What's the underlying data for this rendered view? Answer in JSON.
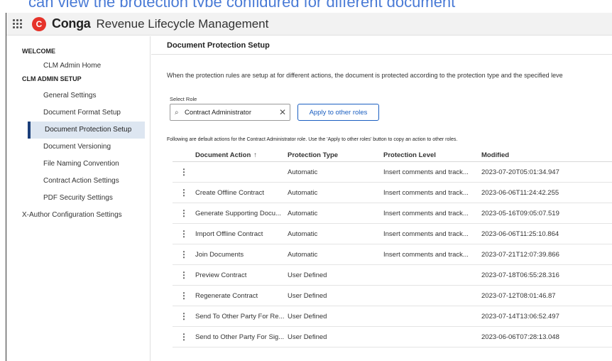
{
  "caption": "can view the protection type configured for different document",
  "header": {
    "brand": "Conga",
    "logo_letter": "C",
    "app_name": "Revenue Lifecycle Management"
  },
  "sidebar": {
    "sections": [
      {
        "title": "WELCOME",
        "items": [
          "CLM Admin Home"
        ]
      },
      {
        "title": "CLM ADMIN SETUP",
        "items": [
          "General Settings",
          "Document Format Setup",
          "Document Protection Setup",
          "Document Versioning",
          "File Naming Convention",
          "Contract Action Settings",
          "PDF Security Settings",
          "X-Author Configuration Settings"
        ]
      }
    ],
    "active_item": "Document Protection Setup"
  },
  "main": {
    "title": "Document Protection Setup",
    "intro": "When the protection rules are setup at for different actions, the document is protected according to the protection type and the specified leve",
    "role_label": "Select Role",
    "role_value": "Contract Administrator",
    "apply_button": "Apply to other roles",
    "note": "Following are default actions for the Contract Administrator role. Use the 'Apply to other roles' button to copy an action to other roles.",
    "table": {
      "headers": [
        "Document Action",
        "Protection Type",
        "Protection Level",
        "Modified"
      ],
      "rows": [
        {
          "action": "",
          "type": "Automatic",
          "level": "Insert comments and track...",
          "modified": "2023-07-20T05:01:34.947"
        },
        {
          "action": "Create Offline Contract",
          "type": "Automatic",
          "level": "Insert comments and track...",
          "modified": "2023-06-06T11:24:42.255"
        },
        {
          "action": "Generate Supporting Docu...",
          "type": "Automatic",
          "level": "Insert comments and track...",
          "modified": "2023-05-16T09:05:07.519"
        },
        {
          "action": "Import Offline Contract",
          "type": "Automatic",
          "level": "Insert comments and track...",
          "modified": "2023-06-06T11:25:10.864"
        },
        {
          "action": "Join Documents",
          "type": "Automatic",
          "level": "Insert comments and track...",
          "modified": "2023-07-21T12:07:39.866"
        },
        {
          "action": "Preview Contract",
          "type": "User Defined",
          "level": "",
          "modified": "2023-07-18T06:55:28.316"
        },
        {
          "action": "Regenerate Contract",
          "type": "User Defined",
          "level": "",
          "modified": "2023-07-12T08:01:46.87"
        },
        {
          "action": "Send To Other Party For Re...",
          "type": "User Defined",
          "level": "",
          "modified": "2023-07-14T13:06:52.497"
        },
        {
          "action": "Send to Other Party For Sig...",
          "type": "User Defined",
          "level": "",
          "modified": "2023-06-06T07:28:13.048"
        }
      ]
    }
  },
  "colors": {
    "brand_red": "#e6332a",
    "accent_blue": "#1b5fc1",
    "active_bg": "#dde6f1",
    "active_bar": "#1b3f7a"
  }
}
